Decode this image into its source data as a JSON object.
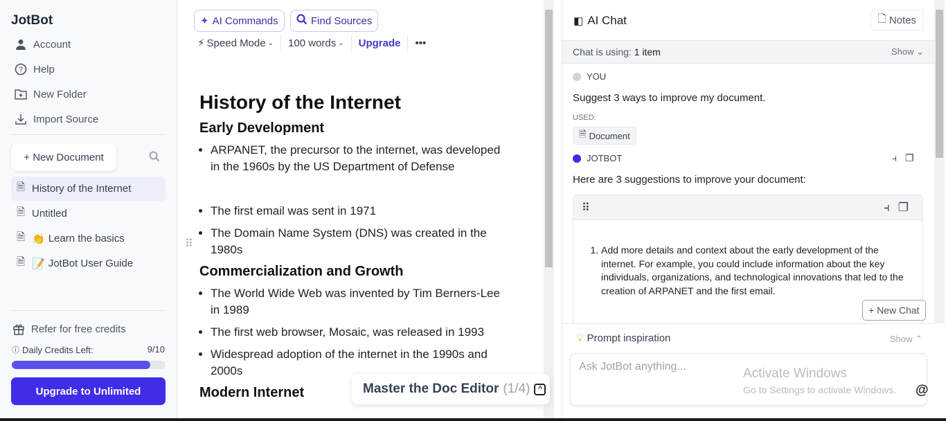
{
  "sidebar": {
    "brand": "JotBot",
    "nav": [
      {
        "label": "Account",
        "icon": "user-icon"
      },
      {
        "label": "Help",
        "icon": "help-circle-icon"
      },
      {
        "label": "New Folder",
        "icon": "folder-plus-icon"
      },
      {
        "label": "Import Source",
        "icon": "download-icon"
      }
    ],
    "new_document": "+ New Document",
    "documents": [
      {
        "label": "History of the Internet",
        "emoji": "",
        "active": true
      },
      {
        "label": "Untitled",
        "emoji": ""
      },
      {
        "label": "Learn the basics",
        "emoji": "👏"
      },
      {
        "label": "JotBot User Guide",
        "emoji": "📝"
      }
    ],
    "refer": "Refer for free credits",
    "credits_label": "Daily Credits Left:",
    "credits_value": "9/10",
    "credits_fraction": 0.9,
    "upgrade": "Upgrade to Unlimited"
  },
  "toolbar": {
    "ai_commands": "AI Commands",
    "find_sources": "Find Sources",
    "speed_mode": "Speed Mode",
    "words": "100 words",
    "upgrade": "Upgrade",
    "more": "•••"
  },
  "document": {
    "title": "History of the Internet",
    "sections": [
      {
        "heading": "Early Development",
        "bullets": [
          "ARPANET, the precursor to the internet, was developed in the 1960s by the US Department of Defense",
          "The first email was sent in 1971",
          "The Domain Name System (DNS) was created in the 1980s"
        ]
      },
      {
        "heading": "Commercialization and Growth",
        "bullets": [
          "The World Wide Web was invented by Tim Berners-Lee in 1989",
          "The first web browser, Mosaic, was released in 1993",
          "Widespread adoption of the internet in the 1990s and 2000s"
        ]
      },
      {
        "heading": "Modern Internet",
        "bullets": []
      }
    ]
  },
  "tour": {
    "label": "Master the Doc Editor",
    "count": "(1/4)"
  },
  "chat": {
    "title": "AI Chat",
    "notes": "Notes",
    "using_prefix": "Chat is using:",
    "using_value": "1 item",
    "show": "Show",
    "you_label": "YOU",
    "you_message": "Suggest 3 ways to improve my document.",
    "used_label": "USED:",
    "used_chip": "Document",
    "bot_label": "JOTBOT",
    "bot_message": "Here are 3 suggestions to improve your document:",
    "suggestion_1": "Add more details and context about the early development of the internet. For example, you could include information about the key individuals, organizations, and technological innovations that led to the creation of ARPANET and the first email.",
    "new_chat": "+ New Chat",
    "prompt_inspiration": "Prompt inspiration",
    "prompt_show": "Show",
    "input_placeholder": "Ask JotBot anything...",
    "at": "@",
    "watermark_title": "Activate Windows",
    "watermark_sub": "Go to Settings to activate Windows.",
    "colors": {
      "accent": "#3f2de8",
      "you_dot": "#d1d5db",
      "bot_dot": "#3b2ee6"
    }
  }
}
